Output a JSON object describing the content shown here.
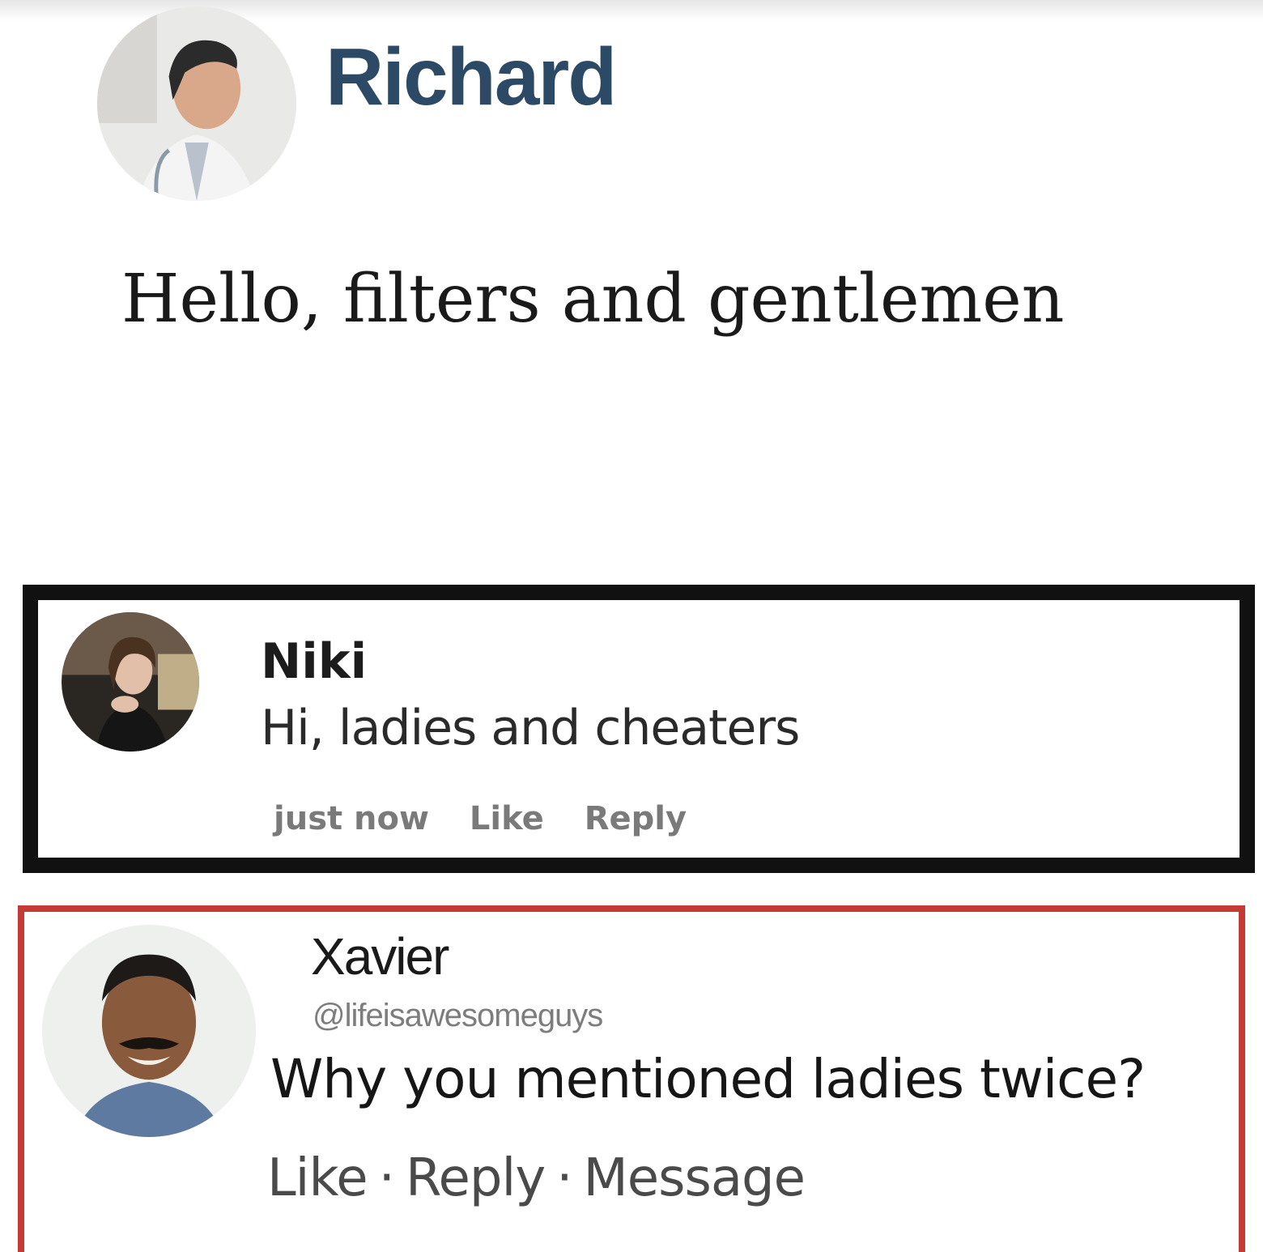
{
  "post": {
    "author": "Richard",
    "body": "Hello, filters and gentlemen"
  },
  "comments": [
    {
      "author": "Niki",
      "text": "Hi, ladies and cheaters",
      "timestamp": "just now",
      "like_label": "Like",
      "reply_label": "Reply",
      "frame_color": "#111111"
    },
    {
      "author": "Xavier",
      "handle": "@lifeisawesomeguys",
      "text": "Why you mentioned ladies twice?",
      "like_label": "Like",
      "reply_label": "Reply",
      "message_label": "Message",
      "separator": "·",
      "frame_color": "#c43a35"
    }
  ]
}
